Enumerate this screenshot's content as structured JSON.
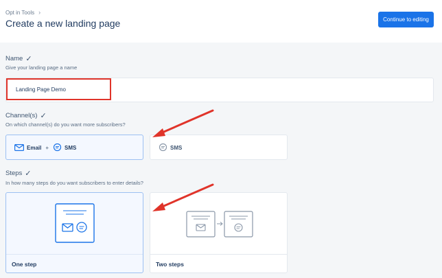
{
  "header": {
    "breadcrumb": "Opt in Tools",
    "title": "Create a new landing page",
    "continue_label": "Continue to editing"
  },
  "name_section": {
    "label": "Name",
    "description": "Give your landing page a name",
    "value": "Landing Page Demo"
  },
  "channels_section": {
    "label": "Channel(s)",
    "description": "On which channel(s) do you want more subscribers?",
    "options": [
      {
        "email": "Email",
        "plus": "+",
        "sms": "SMS",
        "selected": true
      },
      {
        "sms": "SMS",
        "selected": false
      }
    ]
  },
  "steps_section": {
    "label": "Steps",
    "description": "In how many steps do you want subscribers to enter details?",
    "options": [
      {
        "label": "One step",
        "selected": true
      },
      {
        "label": "Two steps",
        "selected": false
      }
    ]
  },
  "colors": {
    "accent": "#1a73e8",
    "highlight_border": "#e0342a",
    "arrow": "#e0342a",
    "selected_bg": "#f4f8ff",
    "selected_border": "#9cc0f2"
  },
  "icons": [
    "chevron-right-icon",
    "check-icon",
    "envelope-icon",
    "chat-bubble-icon",
    "arrow-right-icon"
  ]
}
